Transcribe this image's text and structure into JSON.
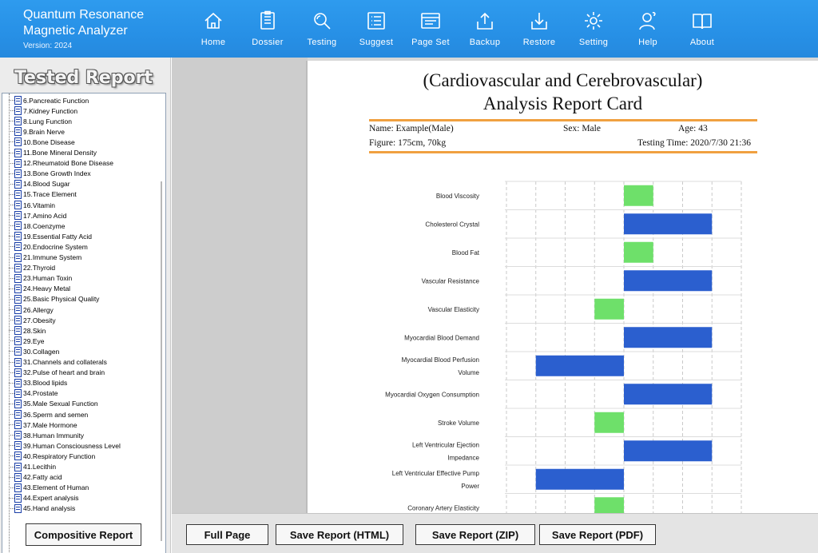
{
  "app": {
    "title_line1": "Quantum Resonance",
    "title_line2": "Magnetic Analyzer",
    "version": "Version: 2024"
  },
  "nav": [
    {
      "label": "Home",
      "icon": "home-icon"
    },
    {
      "label": "Dossier",
      "icon": "dossier-icon"
    },
    {
      "label": "Testing",
      "icon": "magnifier-icon"
    },
    {
      "label": "Suggest",
      "icon": "list-icon"
    },
    {
      "label": "Page Set",
      "icon": "window-icon"
    },
    {
      "label": "Backup",
      "icon": "upload-icon"
    },
    {
      "label": "Restore",
      "icon": "download-icon"
    },
    {
      "label": "Setting",
      "icon": "gear-icon"
    },
    {
      "label": "Help",
      "icon": "help-user-icon"
    },
    {
      "label": "About",
      "icon": "book-icon"
    }
  ],
  "sidebar": {
    "title": "Tested Report",
    "items": [
      "6.Pancreatic Function",
      "7.Kidney Function",
      "8.Lung Function",
      "9.Brain Nerve",
      "10.Bone Disease",
      "11.Bone Mineral Density",
      "12.Rheumatoid Bone Disease",
      "13.Bone Growth Index",
      "14.Blood Sugar",
      "15.Trace Element",
      "16.Vitamin",
      "17.Amino Acid",
      "18.Coenzyme",
      "19.Essential Fatty Acid",
      "20.Endocrine System",
      "21.Immune System",
      "22.Thyroid",
      "23.Human Toxin",
      "24.Heavy Metal",
      "25.Basic Physical Quality",
      "26.Allergy",
      "27.Obesity",
      "28.Skin",
      "29.Eye",
      "30.Collagen",
      "31.Channels and collaterals",
      "32.Pulse of heart and brain",
      "33.Blood lipids",
      "34.Prostate",
      "35.Male Sexual Function",
      "36.Sperm and semen",
      "37.Male Hormone",
      "38.Human Immunity",
      "39.Human Consciousness Level",
      "40.Respiratory Function",
      "41.Lecithin",
      "42.Fatty acid",
      "43.Element of Human",
      "44.Expert analysis",
      "45.Hand analysis"
    ],
    "composite_button": "Compositive Report"
  },
  "report": {
    "title_line1": "(Cardiovascular and Cerebrovascular)",
    "title_line2": "Analysis Report Card",
    "name": "Name: Example(Male)",
    "sex": "Sex: Male",
    "age": "Age: 43",
    "figure": "Figure: 175cm, 70kg",
    "testing_time": "Testing Time: 2020/7/30 21:36"
  },
  "colors": {
    "normal": "#6ee06a",
    "abnormal": "#2b5fcf",
    "accent_line": "#f0a040"
  },
  "chart_data": {
    "type": "bar",
    "orientation": "horizontal",
    "grid": true,
    "categories": [
      [
        "Blood Viscosity"
      ],
      [
        "Cholesterol Crystal"
      ],
      [
        "Blood Fat"
      ],
      [
        "Vascular Resistance"
      ],
      [
        "Vascular Elasticity"
      ],
      [
        "Myocardial Blood Demand"
      ],
      [
        "Myocardial Blood Perfusion",
        "Volume"
      ],
      [
        "Myocardial Oxygen Consumption"
      ],
      [
        "Stroke Volume"
      ],
      [
        "Left Ventricular Ejection",
        "Impedance"
      ],
      [
        "Left Ventricular Effective Pump",
        "Power"
      ],
      [
        "Coronary Artery Elasticity"
      ]
    ],
    "values": [
      1,
      3,
      1,
      3,
      -1,
      3,
      -3,
      3,
      -1,
      3,
      -3,
      -1
    ],
    "status": [
      "normal",
      "abnormal",
      "normal",
      "abnormal",
      "normal",
      "abnormal",
      "abnormal",
      "abnormal",
      "normal",
      "abnormal",
      "abnormal",
      "normal"
    ],
    "xlim": [
      -4,
      4
    ]
  },
  "buttons": {
    "full_page": "Full Page",
    "save_html": "Save Report (HTML)",
    "save_zip": "Save Report (ZIP)",
    "save_pdf": "Save Report (PDF)"
  }
}
